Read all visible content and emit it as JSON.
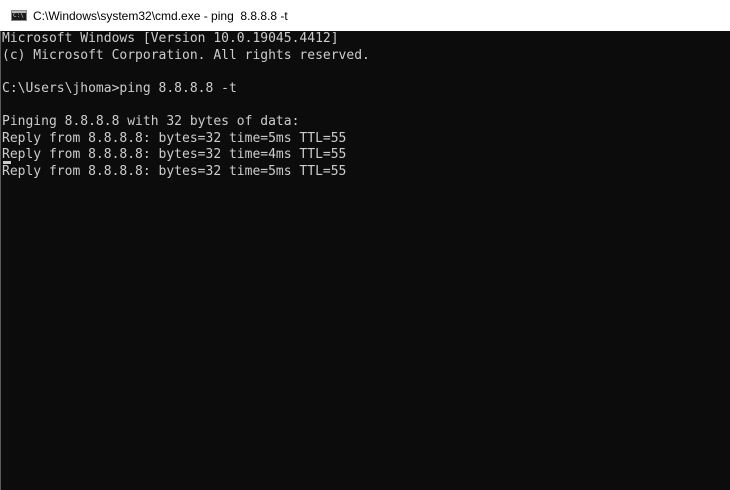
{
  "window": {
    "title": "C:\\Windows\\system32\\cmd.exe - ping  8.8.8.8 -t",
    "icon": "cmd-icon",
    "icon_label": "C:\\"
  },
  "console": {
    "lines": [
      "Microsoft Windows [Version 10.0.19045.4412]",
      "(c) Microsoft Corporation. All rights reserved.",
      "",
      "C:\\Users\\jhoma>ping 8.8.8.8 -t",
      "",
      "Pinging 8.8.8.8 with 32 bytes of data:",
      "Reply from 8.8.8.8: bytes=32 time=5ms TTL=55",
      "Reply from 8.8.8.8: bytes=32 time=4ms TTL=55",
      "Reply from 8.8.8.8: bytes=32 time=5ms TTL=55"
    ],
    "colors": {
      "background": "#0c0c0c",
      "foreground": "#cccccc"
    }
  }
}
